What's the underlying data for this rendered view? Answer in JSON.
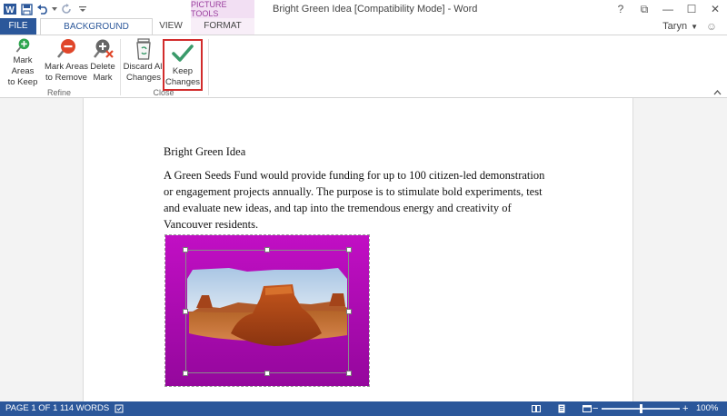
{
  "titlebar": {
    "doc_title": "Bright Green Idea [Compatibility Mode] - Word",
    "contextual_group": "PICTURE TOOLS",
    "help": "?",
    "restore": "⧉",
    "minimize": "—",
    "maximize": "☐",
    "close": "✕"
  },
  "tabs": {
    "file": "FILE",
    "background_removal": "BACKGROUND REMOVAL",
    "view": "VIEW",
    "format": "FORMAT"
  },
  "user": {
    "name": "Taryn"
  },
  "ribbon": {
    "mark_keep": [
      "Mark Areas",
      "to Keep"
    ],
    "mark_remove": [
      "Mark Areas",
      "to Remove"
    ],
    "delete_mark": [
      "Delete",
      "Mark"
    ],
    "discard": [
      "Discard All",
      "Changes"
    ],
    "keep": [
      "Keep",
      "Changes"
    ],
    "group_refine": "Refine",
    "group_close": "Close"
  },
  "document": {
    "heading": "Bright Green Idea",
    "body": "A Green Seeds Fund would provide funding for up to 100 citizen-led demonstration or engagement projects annually. The purpose is to stimulate bold experiments, test and evaluate new ideas, and tap into the tremendous energy and creativity of Vancouver residents."
  },
  "status": {
    "page": "PAGE 1 OF 1",
    "words": "114 WORDS",
    "zoom_minus": "−",
    "zoom_plus": "+",
    "zoom": "100%",
    "zoom_level": 0.5
  },
  "colors": {
    "accent": "#2b579a",
    "magenta": "#b40ab8",
    "check": "#3a9a6a",
    "highlight": "#d22c2c"
  }
}
